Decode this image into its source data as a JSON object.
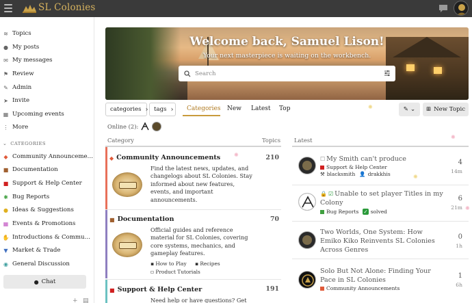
{
  "header": {
    "site_title": "SL Colonies"
  },
  "sidebar": {
    "items": [
      {
        "label": "Topics",
        "icon": "layers-icon"
      },
      {
        "label": "My posts",
        "icon": "user-icon"
      },
      {
        "label": "My messages",
        "icon": "envelope-icon"
      },
      {
        "label": "Review",
        "icon": "flag-icon"
      },
      {
        "label": "Admin",
        "icon": "wrench-icon"
      },
      {
        "label": "Invite",
        "icon": "paper-plane-icon"
      },
      {
        "label": "Upcoming events",
        "icon": "calendar-icon"
      },
      {
        "label": "More",
        "icon": "more-icon"
      }
    ],
    "categories_heading": "CATEGORIES",
    "categories": [
      {
        "label": "Community Announceme…",
        "icon": "bell-icon",
        "color": "#e05a3a"
      },
      {
        "label": "Documentation",
        "icon": "book-icon",
        "color": "#a06030"
      },
      {
        "label": "Support & Help Center",
        "icon": "support-icon",
        "color": "#d02020"
      },
      {
        "label": "Bug Reports",
        "icon": "bug-icon",
        "color": "#40a040"
      },
      {
        "label": "Ideas & Suggestions",
        "icon": "lightbulb-icon",
        "color": "#e0b020"
      },
      {
        "label": "Events & Promotions",
        "icon": "calendar-icon",
        "color": "#c050c0"
      },
      {
        "label": "Introductions & Commu…",
        "icon": "wave-icon",
        "color": "#d08040"
      },
      {
        "label": "Market & Trade",
        "icon": "cart-icon",
        "color": "#4070c0"
      },
      {
        "label": "General Discussion",
        "icon": "chat-icon",
        "color": "#40a0a0"
      }
    ],
    "chat_label": "Chat",
    "footer_plus": "+"
  },
  "hero": {
    "title": "Welcome back, Samuel Lison!",
    "subtitle": "Your next masterpiece is waiting on the workbench.",
    "search_placeholder": "Search"
  },
  "nav": {
    "categories_filter": "categories",
    "tags_filter": "tags",
    "tabs": [
      "Categories",
      "New",
      "Latest",
      "Top"
    ],
    "active_tab": "Categories",
    "new_topic_label": "New Topic"
  },
  "online": {
    "label": "Online (2):"
  },
  "categories_table": {
    "col_category": "Category",
    "col_topics": "Topics",
    "rows": [
      {
        "title": "Community Announcements",
        "icon": "bell-icon",
        "color": "#e8705a",
        "topics": "210",
        "description": "Find the latest news, updates, and changelogs about SL Colonies. Stay informed about new features, events, and important announcements."
      },
      {
        "title": "Documentation",
        "icon": "book-icon",
        "color": "#8e7fc0",
        "topics": "70",
        "description": "Official guides and reference material for SL Colonies, covering core systems, mechanics, and gameplay features.",
        "subcategories": [
          "How to Play",
          "Recipes",
          "Product Tutorials"
        ]
      },
      {
        "title": "Support & Help Center",
        "icon": "support-icon",
        "color": "#6cc2c2",
        "topics": "191",
        "description": "Need help or have questions? Get"
      }
    ]
  },
  "latest": {
    "heading": "Latest",
    "topics": [
      {
        "title": "My Smith can't produce",
        "status_icon": "unchecked-icon",
        "category": "Support & Help Center",
        "category_color": "#d02020",
        "extra": [
          "blacksmith",
          "drakkhis"
        ],
        "replies": "4",
        "time": "14m"
      },
      {
        "title": "Unable to set player Titles in my Colony",
        "status_icon": "lock-check-icon",
        "category": "Bug Reports",
        "category_color": "#40a040",
        "extra": [
          "solved"
        ],
        "replies": "6",
        "time": "21m"
      },
      {
        "title": "Two Worlds, One System: How Emiko Kiko Reinvents SL Colonies Across Genres",
        "status_icon": "",
        "category": "",
        "category_color": "",
        "extra": [],
        "replies": "0",
        "time": "1h"
      },
      {
        "title": "Solo But Not Alone: Finding Your Pace in SL Colonies",
        "status_icon": "",
        "category": "Community Announcements",
        "category_color": "#e05a3a",
        "extra": [],
        "replies": "1",
        "time": "6h"
      }
    ]
  }
}
